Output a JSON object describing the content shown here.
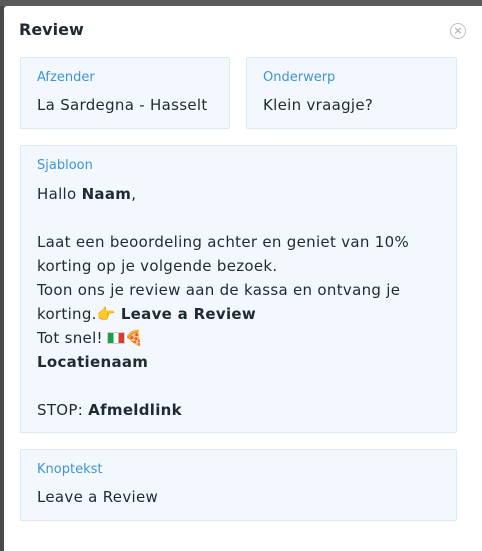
{
  "modal": {
    "title": "Review",
    "close_icon": "×"
  },
  "sender": {
    "label": "Afzender",
    "value": "La Sardegna - Hasselt"
  },
  "subject": {
    "label": "Onderwerp",
    "value": "Klein vraagje?"
  },
  "template": {
    "label": "Sjabloon",
    "greeting_prefix": "Hallo ",
    "greeting_name": "Naam",
    "greeting_suffix": ",",
    "paragraph1": "Laat een beoordeling achter en geniet van 10% korting op je volgende bezoek.",
    "paragraph2_text": "Toon ons je review aan de kassa en ontvang je korting.",
    "pointing_emoji": "👉",
    "paragraph2_link": "Leave a Review",
    "closing_text": "Tot snel!",
    "pizza_emoji": "🍕",
    "location_name": "Locatienaam",
    "stop_prefix": "STOP: ",
    "stop_link": "Afmeldlink"
  },
  "button_text": {
    "label": "Knoptekst",
    "value": "Leave a Review"
  }
}
